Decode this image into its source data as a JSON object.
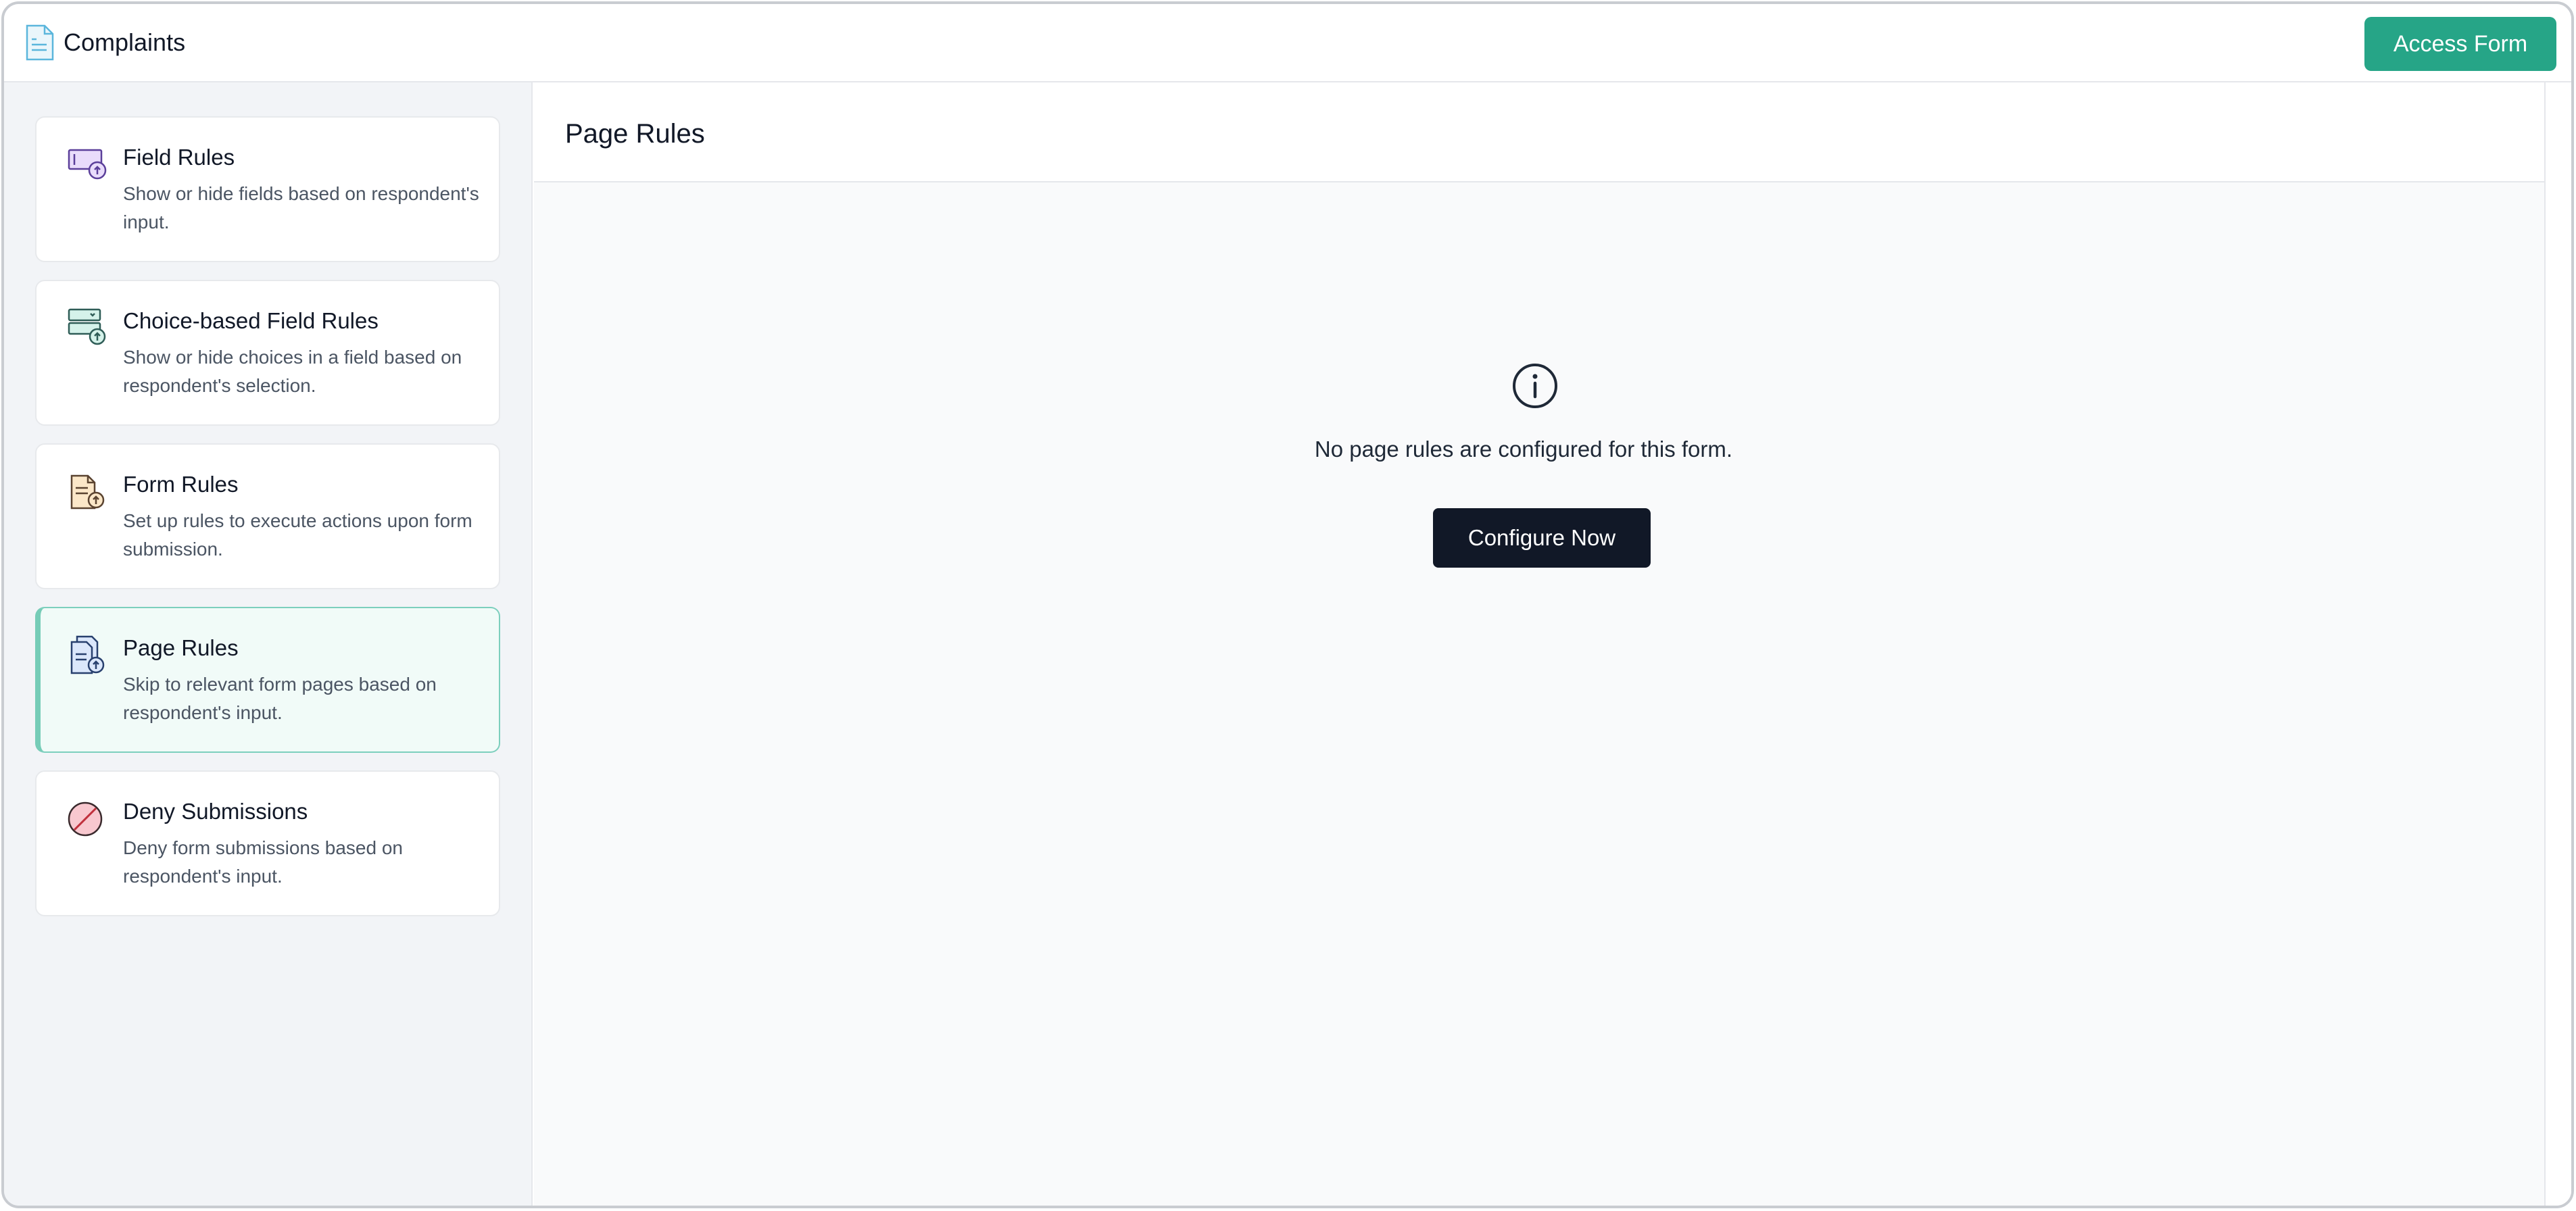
{
  "header": {
    "title": "Complaints",
    "access_form_label": "Access Form"
  },
  "sidebar": {
    "items": [
      {
        "title": "Field Rules",
        "description": "Show or hide fields based on respondent's input.",
        "icon": "field-rules-icon",
        "active": false
      },
      {
        "title": "Choice-based Field Rules",
        "description": "Show or hide choices in a field based on respondent's selection.",
        "icon": "choice-rules-icon",
        "active": false
      },
      {
        "title": "Form Rules",
        "description": "Set up rules to execute actions upon form submission.",
        "icon": "form-rules-icon",
        "active": false
      },
      {
        "title": "Page Rules",
        "description": "Skip to relevant form pages based on respondent's input.",
        "icon": "page-rules-icon",
        "active": true
      },
      {
        "title": "Deny Submissions",
        "description": "Deny form submissions based on respondent's input.",
        "icon": "deny-icon",
        "active": false
      }
    ]
  },
  "main": {
    "title": "Page Rules",
    "empty_message": "No page rules are configured for this form.",
    "configure_label": "Configure Now"
  },
  "colors": {
    "accent": "#26a587",
    "active_card_bg": "#f1fbf8",
    "active_card_border": "#76ccb7",
    "primary_button": "#111827"
  }
}
